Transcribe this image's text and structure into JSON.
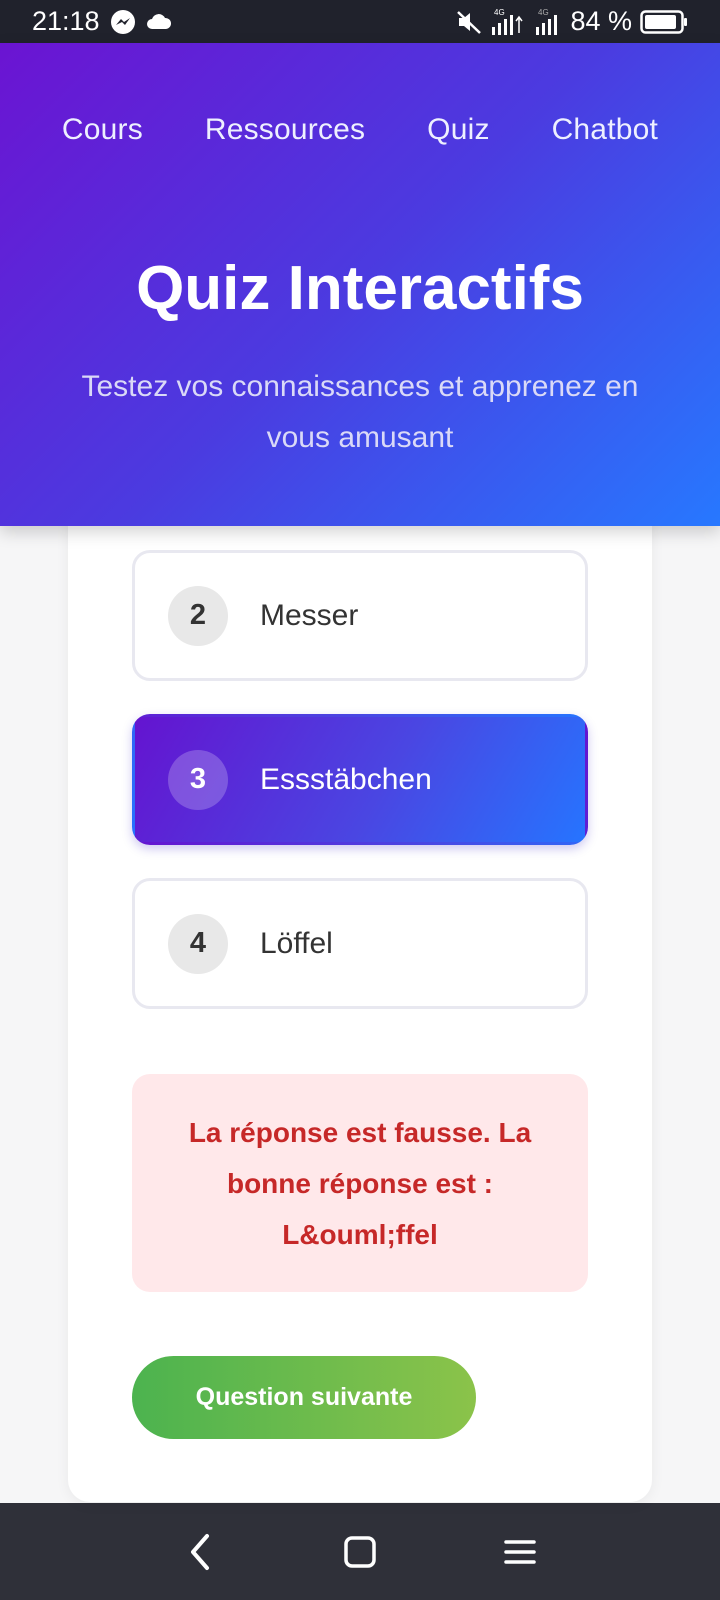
{
  "status_bar": {
    "time": "21:18",
    "notification_icons": [
      "messenger-icon",
      "cloud-icon"
    ],
    "system_icons": [
      "mute-icon",
      "signal-4g-icon",
      "signal-icon",
      "battery-icon"
    ],
    "battery": "84 %"
  },
  "nav": {
    "items": [
      {
        "label": "Cours"
      },
      {
        "label": "Ressources"
      },
      {
        "label": "Quiz"
      },
      {
        "label": "Chatbot"
      }
    ]
  },
  "hero": {
    "title": "Quiz Interactifs",
    "subtitle": "Testez vos connaissances et apprenez en vous amusant"
  },
  "quiz": {
    "options": [
      {
        "number": "2",
        "label": "Messer",
        "selected": false
      },
      {
        "number": "3",
        "label": "Essstäbchen",
        "selected": true
      },
      {
        "number": "4",
        "label": "Löffel",
        "selected": false
      }
    ],
    "feedback": "La réponse est fausse. La bonne réponse est : L&ouml;ffel",
    "next_label": "Question suivante"
  },
  "colors": {
    "hero_gradient_start": "#6b14d2",
    "hero_gradient_end": "#2778ff",
    "error_text": "#c62828",
    "error_bg": "#ffe8ea",
    "next_gradient_start": "#4cb34f",
    "next_gradient_end": "#8bc34a"
  },
  "system_nav": [
    "back-icon",
    "home-icon",
    "menu-icon"
  ]
}
